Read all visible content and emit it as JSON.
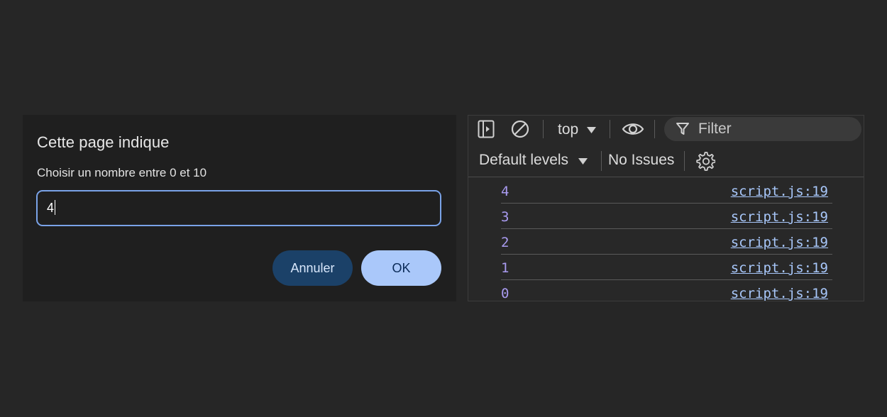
{
  "dialog": {
    "title": "Cette page indique",
    "message": "Choisir un nombre entre 0 et 10",
    "input_value": "4",
    "cancel_label": "Annuler",
    "ok_label": "OK"
  },
  "devtools": {
    "toolbar": {
      "sidebar_icon": "sidebar-toggle-icon",
      "clear_icon": "clear-console-icon",
      "context_label": "top",
      "eye_icon": "eye-icon",
      "filter_placeholder": "Filter",
      "levels_label": "Default levels",
      "issues_label": "No Issues",
      "settings_icon": "gear-icon"
    },
    "logs": [
      {
        "value": "4",
        "source": "script.js:19"
      },
      {
        "value": "3",
        "source": "script.js:19"
      },
      {
        "value": "2",
        "source": "script.js:19"
      },
      {
        "value": "1",
        "source": "script.js:19"
      },
      {
        "value": "0",
        "source": "script.js:19"
      }
    ]
  },
  "colors": {
    "background": "#262626",
    "dialog_bg": "#1f1f1f",
    "input_border": "#7aa3e8",
    "cancel_bg": "#1b4168",
    "ok_bg": "#aac8fa",
    "log_value": "#a99bf0",
    "log_link": "#a8c7fa"
  }
}
